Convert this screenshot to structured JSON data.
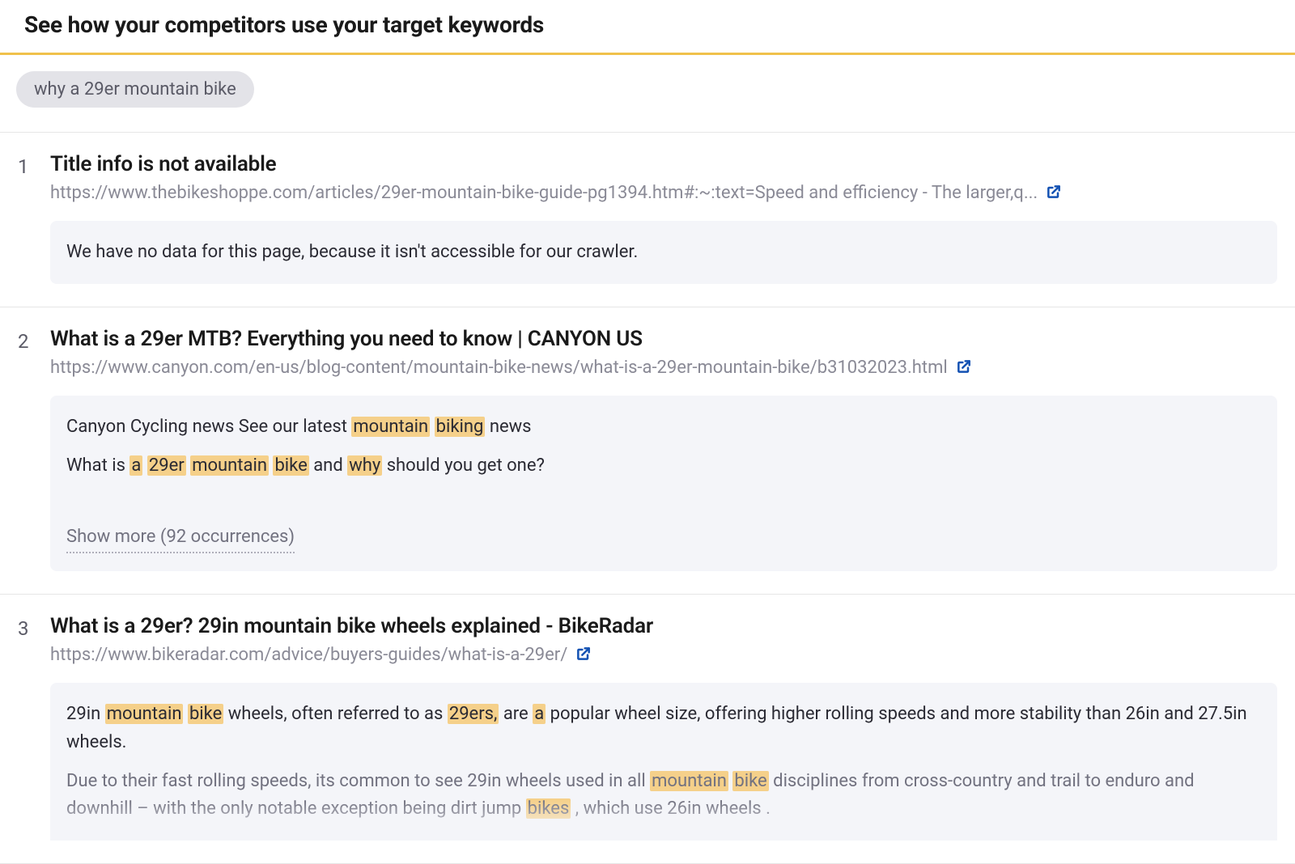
{
  "header": {
    "title": "See how your competitors use your target keywords"
  },
  "chip": {
    "label": "why a 29er mountain bike"
  },
  "results": [
    {
      "num": "1",
      "title": "Title info is not available",
      "url": "https://www.thebikeshoppe.com/articles/29er-mountain-bike-guide-pg1394.htm#:~:text=Speed and efficiency - The larger,q...",
      "snippet_plain": "We have no data for this page, because it isn't accessible for our crawler."
    },
    {
      "num": "2",
      "title": "What is a 29er MTB? Everything you need to know | CANYON US",
      "url": "https://www.canyon.com/en-us/blog-content/mountain-bike-news/what-is-a-29er-mountain-bike/b31032023.html",
      "lines": [
        [
          {
            "t": "Canyon Cycling news See our latest "
          },
          {
            "t": "mountain",
            "hl": true
          },
          {
            "t": " "
          },
          {
            "t": "biking",
            "hl": true
          },
          {
            "t": " news"
          }
        ],
        [
          {
            "t": "What is "
          },
          {
            "t": "a",
            "hl": true
          },
          {
            "t": " "
          },
          {
            "t": "29er",
            "hl": true
          },
          {
            "t": " "
          },
          {
            "t": "mountain",
            "hl": true
          },
          {
            "t": " "
          },
          {
            "t": "bike",
            "hl": true
          },
          {
            "t": " and "
          },
          {
            "t": "why",
            "hl": true
          },
          {
            "t": " should you get one?"
          }
        ]
      ],
      "show_more": "Show more (92 occurrences)"
    },
    {
      "num": "3",
      "title": "What is a 29er? 29in mountain bike wheels explained - BikeRadar",
      "url": "https://www.bikeradar.com/advice/buyers-guides/what-is-a-29er/",
      "lines": [
        [
          {
            "t": "29in "
          },
          {
            "t": "mountain",
            "hl": true
          },
          {
            "t": " "
          },
          {
            "t": "bike",
            "hl": true
          },
          {
            "t": " wheels, often referred to as "
          },
          {
            "t": "29ers,",
            "hl": true
          },
          {
            "t": " are "
          },
          {
            "t": "a",
            "hl": true
          },
          {
            "t": " popular wheel size, offering higher rolling speeds and more stability than 26in and 27.5in wheels."
          }
        ],
        [
          {
            "t": "Due to their fast rolling speeds, its common to see 29in wheels used in all "
          },
          {
            "t": "mountain",
            "hl": true
          },
          {
            "t": " "
          },
          {
            "t": "bike",
            "hl": true
          },
          {
            "t": " disciplines from cross-country and trail to enduro and downhill – with the only notable exception being dirt jump "
          },
          {
            "t": "bikes",
            "hl": true
          },
          {
            "t": " , which use 26in wheels ."
          }
        ]
      ],
      "fade_second": true
    }
  ]
}
